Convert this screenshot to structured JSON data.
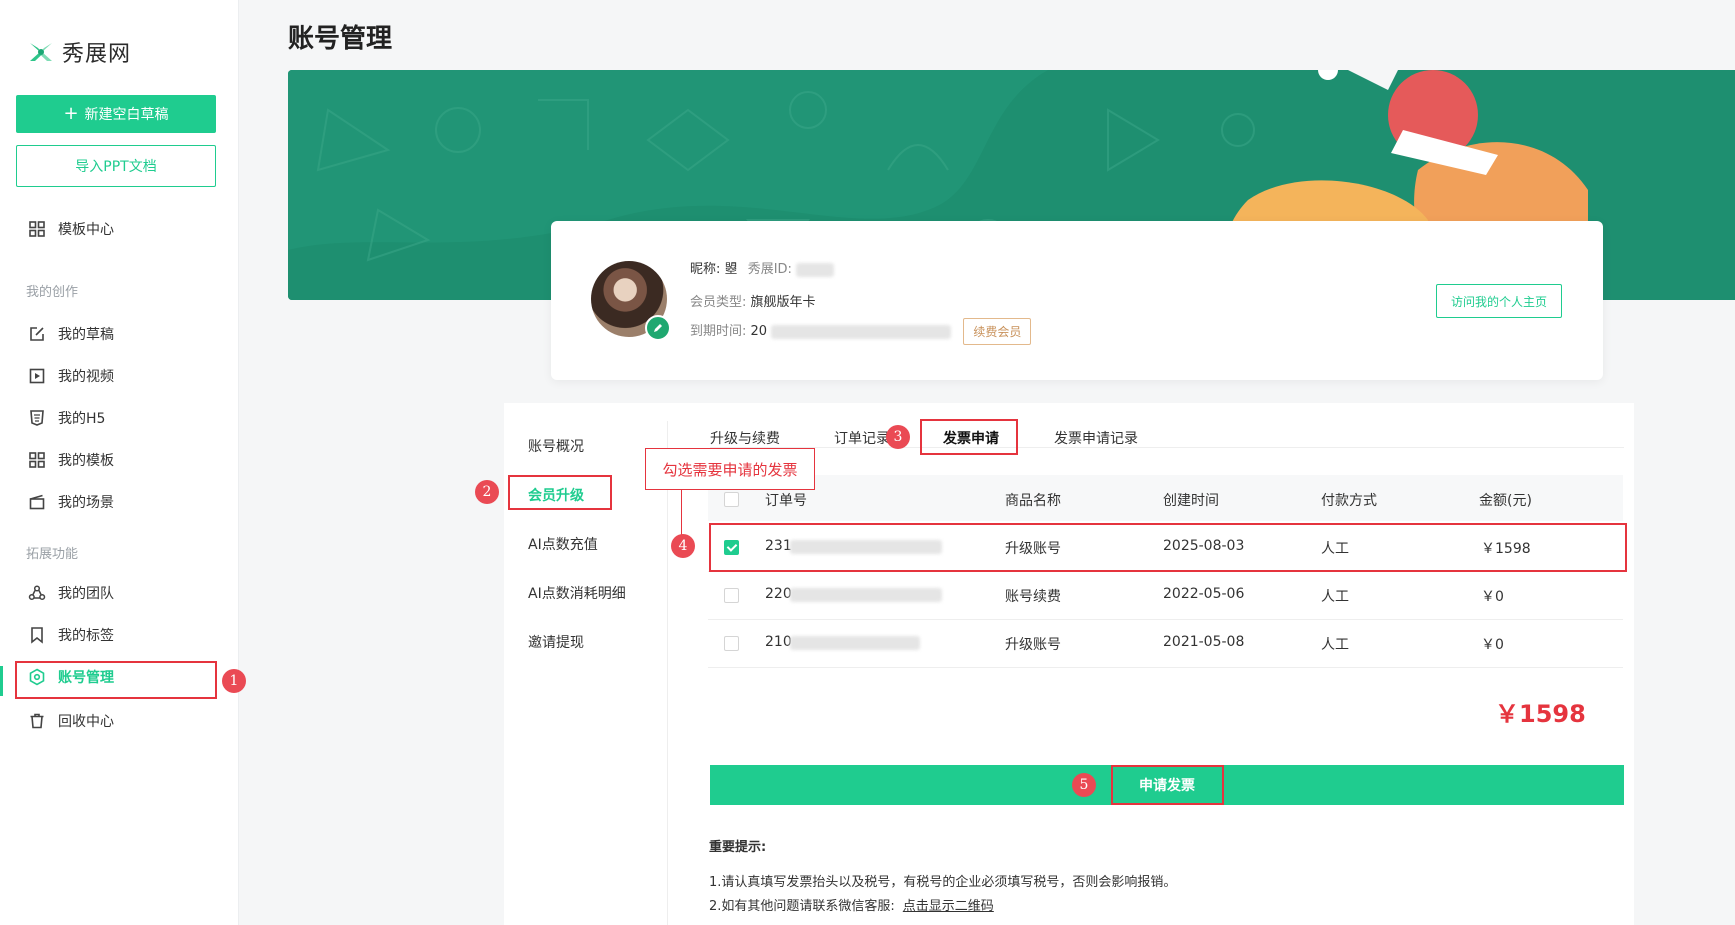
{
  "brand": {
    "name": "秀展网",
    "color": "#1fcc8f"
  },
  "sidebar": {
    "new_draft": "新建空白草稿",
    "import_ppt": "导入PPT文档",
    "template_center": "模板中心",
    "section_creation": "我的创作",
    "creation_items": [
      {
        "label": "我的草稿",
        "icon": "edit-icon"
      },
      {
        "label": "我的视频",
        "icon": "video-icon"
      },
      {
        "label": "我的H5",
        "icon": "h5-icon"
      },
      {
        "label": "我的模板",
        "icon": "grid-icon"
      },
      {
        "label": "我的场景",
        "icon": "scene-icon"
      }
    ],
    "section_extension": "拓展功能",
    "extension_items": [
      {
        "label": "我的团队",
        "icon": "team-icon"
      },
      {
        "label": "我的标签",
        "icon": "bookmark-icon"
      },
      {
        "label": "账号管理",
        "icon": "account-icon"
      },
      {
        "label": "回收中心",
        "icon": "trash-icon"
      }
    ],
    "active_item": "账号管理"
  },
  "page": {
    "title": "账号管理"
  },
  "profile": {
    "nickname_label": "昵称:",
    "nickname": "曌",
    "id_label": "秀展ID:",
    "member_type_label": "会员类型:",
    "member_type": "旗舰版年卡",
    "expire_label": "到期时间:",
    "expire_prefix": "20",
    "renew_button": "续费会员",
    "visit_button": "访问我的个人主页"
  },
  "submenu": [
    "账号概况",
    "会员升级",
    "AI点数充值",
    "AI点数消耗明细",
    "邀请提现"
  ],
  "tabs": [
    "升级与续费",
    "订单记录",
    "发票申请",
    "发票申请记录"
  ],
  "active_tab": "发票申请",
  "callout": "勾选需要申请的发票",
  "table": {
    "headers": [
      "订单号",
      "商品名称",
      "创建时间",
      "付款方式",
      "金额(元)"
    ],
    "rows": [
      {
        "checked": true,
        "order_prefix": "231",
        "product": "升级账号",
        "created": "2025-08-03",
        "payment": "人工",
        "amount": "￥1598"
      },
      {
        "checked": false,
        "order_prefix": "220",
        "product": "账号续费",
        "created": "2022-05-06",
        "payment": "人工",
        "amount": "￥0"
      },
      {
        "checked": false,
        "order_prefix": "210",
        "product": "升级账号",
        "created": "2021-05-08",
        "payment": "人工",
        "amount": "￥0"
      }
    ]
  },
  "total": "￥1598",
  "apply_button": "申请发票",
  "tips": {
    "title": "重要提示:",
    "line1": "1.请认真填写发票抬头以及税号，有税号的企业必须填写税号，否则会影响报销。",
    "line2": "2.如有其他问题请联系微信客服:",
    "qr_link": "点击显示二维码"
  },
  "annotations": [
    "1",
    "2",
    "3",
    "4",
    "5"
  ],
  "colors": {
    "accent": "#1fcc8f",
    "highlight": "#e5343e",
    "banner": "#1f9070"
  }
}
